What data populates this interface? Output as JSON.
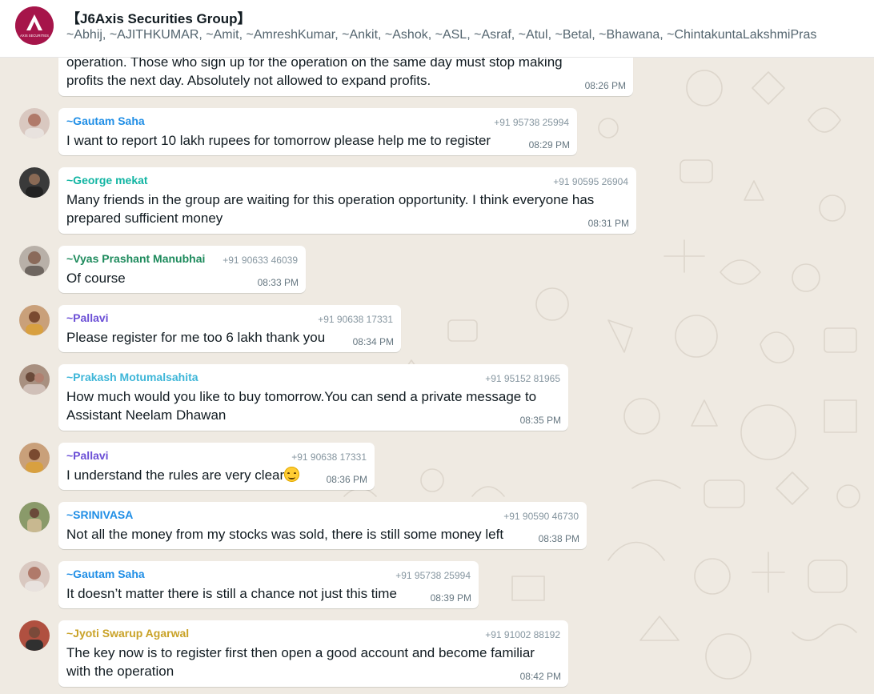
{
  "header": {
    "title": "【J6Axis Securities Group】",
    "members": "~Abhij, ~AJITHKUMAR, ~Amit, ~AmreshKumar, ~Ankit, ~Ashok, ~ASL, ~Asraf, ~Atul, ~Betal, ~Bhawana, ~ChintakuntaLakshmiPras",
    "avatar_logo_text": "AXIS SECURITIES",
    "avatar_color": "#a6154a"
  },
  "messages": [
    {
      "id": "m0",
      "line1": "operation. Those who sign up for the operation on the same day must stop making",
      "line2": "profits the next day. Absolutely not allowed to expand profits.",
      "time": "08:26 PM"
    },
    {
      "id": "m1",
      "sender": "~Gautam Saha",
      "sender_color": "#1f8ee6",
      "phone": "+91 95738 25994",
      "text": "I want to report 10 lakh rupees for tomorrow please help me to register",
      "time": "08:29 PM"
    },
    {
      "id": "m2",
      "sender": "~George mekat",
      "sender_color": "#12b5a3",
      "phone": "+91 90595 26904",
      "line1": "Many friends in the group are waiting for this operation opportunity. I think everyone has",
      "line2": "prepared sufficient money",
      "time": "08:31 PM"
    },
    {
      "id": "m3",
      "sender": "~Vyas Prashant Manubhai",
      "sender_color": "#1d8a5c",
      "phone": "+91 90633 46039",
      "text": "Of course",
      "time": "08:33 PM"
    },
    {
      "id": "m4",
      "sender": "~Pallavi",
      "sender_color": "#6b4fd6",
      "phone": "+91 90638 17331",
      "text": "Please register for me too 6 lakh thank you",
      "time": "08:34 PM"
    },
    {
      "id": "m5",
      "sender": "~Prakash Motumalsahita",
      "sender_color": "#3eb6d8",
      "phone": "+91 95152 81965",
      "line1": "How much would you like to buy tomorrow.You can send a private message to",
      "line2": "Assistant Neelam Dhawan",
      "time": "08:35 PM"
    },
    {
      "id": "m6",
      "sender": "~Pallavi",
      "sender_color": "#6b4fd6",
      "phone": "+91 90638 17331",
      "text": "I understand the rules are very clear",
      "emoji": "smiling-face-icon",
      "time": "08:36 PM"
    },
    {
      "id": "m7",
      "sender": "~SRINIVASA",
      "sender_color": "#1f8ee6",
      "phone": "+91 90590 46730",
      "text": "Not all the money from my stocks was sold, there is still some money left",
      "time": "08:38 PM"
    },
    {
      "id": "m8",
      "sender": "~Gautam Saha",
      "sender_color": "#1f8ee6",
      "phone": "+91 95738 25994",
      "text": "It doesn’t matter there is still a chance not just this time",
      "time": "08:39 PM"
    },
    {
      "id": "m9",
      "sender": "~Jyoti Swarup Agarwal",
      "sender_color": "#c9a227",
      "phone": "+91 91002 88192",
      "line1": "The key now is to register first then open a good account and become familiar",
      "line2": "with the operation",
      "time": "08:42 PM"
    }
  ]
}
